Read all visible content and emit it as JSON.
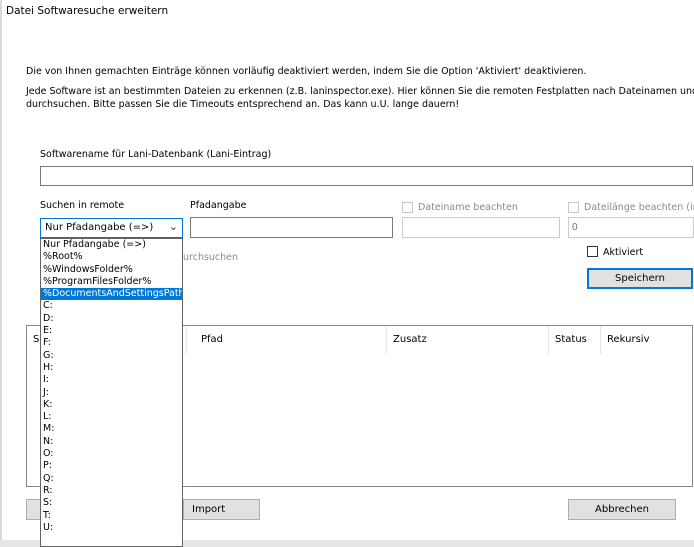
{
  "window": {
    "title": "Datei Softwaresuche erweitern"
  },
  "intro": {
    "line1": "Die von Ihnen gemachten Einträge können vorläufig deaktiviert werden, indem Sie die Option 'Aktiviert' deaktivieren.",
    "line2": "Jede Software ist an bestimmten Dateien zu erkennen (z.B. laninspector.exe). Hier können Sie die remoten Festplatten nach Dateinamen und l",
    "line3": "durchsuchen. Bitte passen Sie die Timeouts entsprechend an. Das kann u.U. lange dauern!"
  },
  "form": {
    "softwarename_label": "Softwarename für Lani-Datenbank (Lani-Eintrag)",
    "softwarename_value": "",
    "suchen_label": "Suchen in remote",
    "suchen_selected": "Nur Pfadangabe (=>)",
    "pfad_label": "Pfadangabe",
    "pfad_value": "",
    "dateiname_label": "Dateiname beachten",
    "dateiname_value": "",
    "dateilaenge_label": "Dateilänge beachten (in",
    "dateilaenge_value": "0",
    "rekursiv_label_partial": "urchsuchen",
    "aktiviert_label": "Aktiviert",
    "save_label": "Speichern"
  },
  "dropdown": {
    "selected_index": 4,
    "options": [
      "Nur Pfadangabe (=>)",
      "%Root%",
      "%WindowsFolder%",
      "%ProgramFilesFolder%",
      "%DocumentsAndSettingsPath%",
      "C:",
      "D:",
      "E:",
      "F:",
      "G:",
      "H:",
      "I:",
      "J:",
      "K:",
      "L:",
      "M:",
      "N:",
      "O:",
      "P:",
      "Q:",
      "R:",
      "S:",
      "T:",
      "U:"
    ]
  },
  "table": {
    "columns": [
      "S",
      "Pfad",
      "Zusatz",
      "Status",
      "Rekursiv"
    ]
  },
  "buttons": {
    "import_label": "Import",
    "cancel_label": "Abbrechen"
  },
  "colors": {
    "accent": "#0078d7",
    "selection": "#0078d7"
  }
}
